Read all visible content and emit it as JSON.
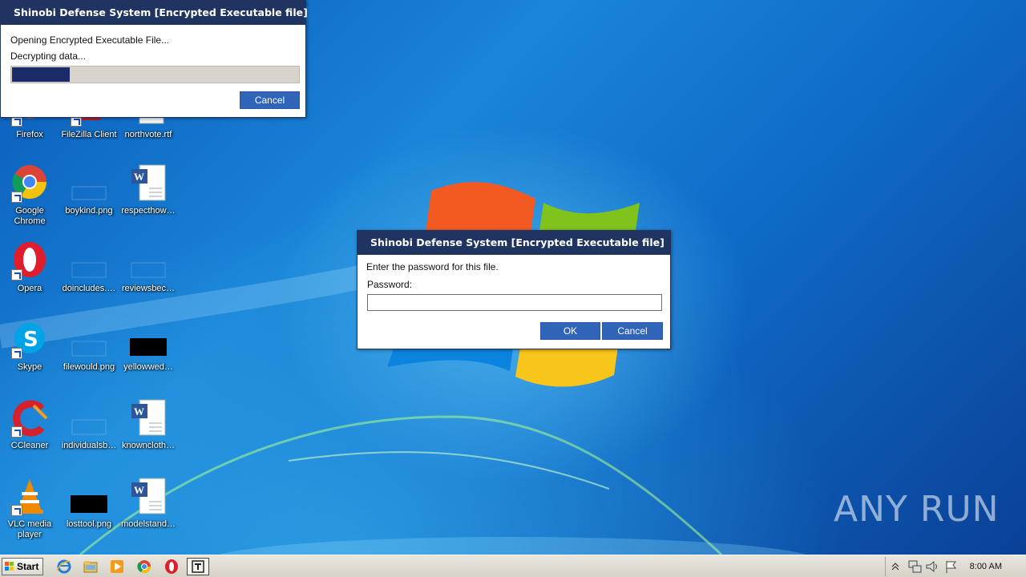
{
  "desktop": {
    "icons": [
      {
        "label": "Firefox",
        "shortcut": true
      },
      {
        "label": "FileZilla Client",
        "shortcut": true
      },
      {
        "label": "northvote.rtf",
        "shortcut": false
      },
      {
        "label": "Google Chrome",
        "shortcut": true
      },
      {
        "label": "boykind.png",
        "shortcut": false
      },
      {
        "label": "respecthow…",
        "shortcut": false
      },
      {
        "label": "Opera",
        "shortcut": true
      },
      {
        "label": "doincludes.…",
        "shortcut": false
      },
      {
        "label": "reviewsbec…",
        "shortcut": false
      },
      {
        "label": "Skype",
        "shortcut": true
      },
      {
        "label": "filewould.png",
        "shortcut": false
      },
      {
        "label": "yellowwed…",
        "shortcut": false
      },
      {
        "label": "CCleaner",
        "shortcut": true
      },
      {
        "label": "individualsb…",
        "shortcut": false
      },
      {
        "label": "knowncloth…",
        "shortcut": false
      },
      {
        "label": "VLC media player",
        "shortcut": true
      },
      {
        "label": "losttool.png",
        "shortcut": false
      },
      {
        "label": "modelstand…",
        "shortcut": false
      }
    ]
  },
  "progress_dialog": {
    "title": "Shinobi Defense System [Encrypted Executable file]",
    "line1": "Opening Encrypted Executable File...",
    "line2": "Decrypting data...",
    "progress_fraction": 0.2,
    "cancel_label": "Cancel"
  },
  "password_dialog": {
    "title": "Shinobi Defense System [Encrypted Executable file]",
    "prompt": "Enter the password for this file.",
    "password_label": "Password:",
    "password_value": "",
    "ok_label": "OK",
    "cancel_label": "Cancel"
  },
  "taskbar": {
    "start_label": "Start",
    "pinned": [
      "internet-explorer-icon",
      "explorer-folder-icon",
      "media-player-icon",
      "chrome-icon",
      "opera-icon",
      "shinobi-app-icon"
    ],
    "clock": "8:00 AM"
  },
  "watermark": "ANY RUN",
  "colors": {
    "dialog_title_bg": "#1f3461",
    "button_bg": "#2f64b9",
    "progress_fill": "#1b2b6a"
  }
}
